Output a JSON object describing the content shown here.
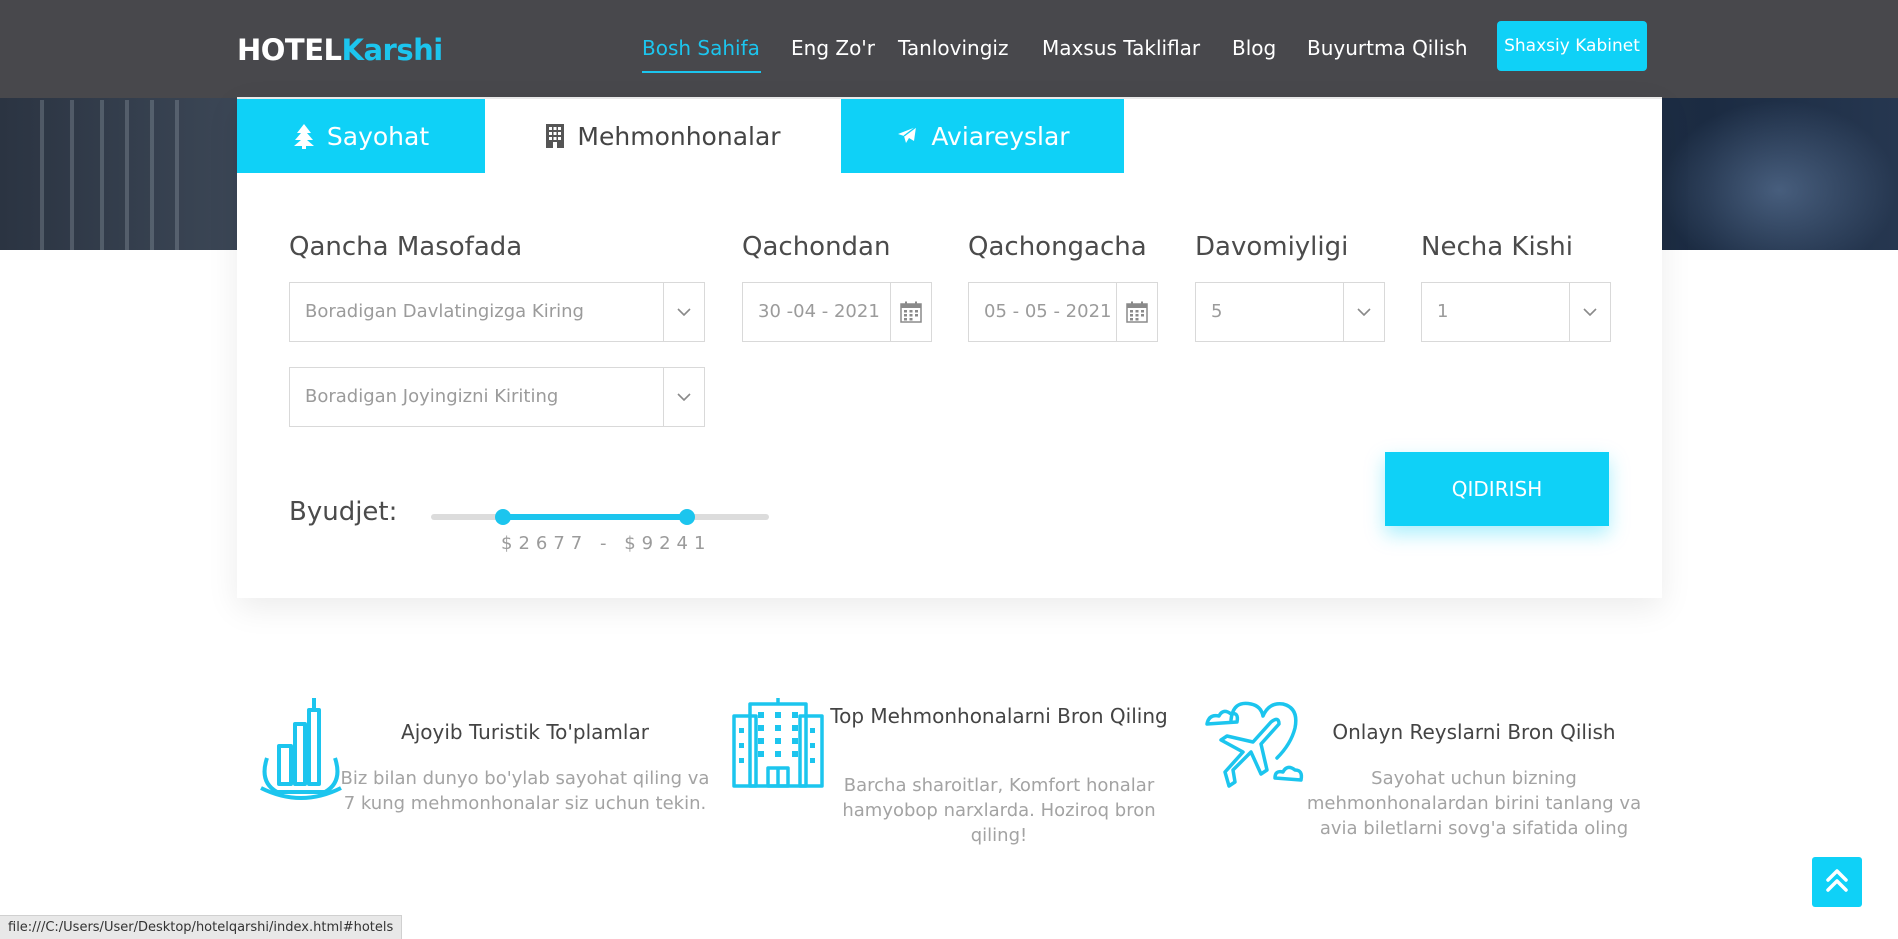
{
  "brand": {
    "part1": "HOTEL",
    "part2": "Karshi"
  },
  "nav": {
    "items": [
      {
        "label": "Bosh Sahifa",
        "active": true
      },
      {
        "label": "Eng Zo'r"
      },
      {
        "label": "Tanlovingiz"
      },
      {
        "label": "Maxsus Takliflar"
      },
      {
        "label": "Blog"
      },
      {
        "label": "Buyurtma Qilish"
      }
    ],
    "cabinet_label": "Shaxsiy Kabinet"
  },
  "tabs": [
    {
      "label": "Sayohat",
      "icon": "tree-icon",
      "active": false
    },
    {
      "label": "Mehmonhonalar",
      "icon": "building-icon",
      "active": true
    },
    {
      "label": "Aviareyslar",
      "icon": "plane-icon",
      "active": false
    }
  ],
  "search": {
    "distance": {
      "label": "Qancha Masofada",
      "country_placeholder": "Boradigan Davlatingizga Kiring",
      "place_placeholder": "Boradigan Joyingizni Kiriting"
    },
    "from": {
      "label": "Qachondan",
      "value": "30 -04 - 2021"
    },
    "to": {
      "label": "Qachongacha",
      "value": "05 - 05 - 2021"
    },
    "duration": {
      "label": "Davomiyligi",
      "value": "5"
    },
    "people": {
      "label": "Necha Kishi",
      "value": "1"
    },
    "budget": {
      "label": "Byudjet:",
      "range": "$2677 - $9241",
      "min": 2677,
      "max": 9241
    },
    "submit_label": "QIDIRISH"
  },
  "features": [
    {
      "icon": "tourist-package-icon",
      "title": "Ajoyib Turistik To'plamlar",
      "description": "Biz bilan dunyo bo'ylab sayohat qiling va 7 kung mehmonhonalar siz uchun tekin."
    },
    {
      "icon": "hotel-building-icon",
      "title": "Top Mehmonhonalarni Bron Qiling",
      "description": "Barcha sharoitlar, Komfort honalar hamyobop narxlarda. Hoziroq bron qiling!"
    },
    {
      "icon": "airplane-heart-icon",
      "title": "Onlayn Reyslarni Bron Qilish",
      "description": "Sayohat uchun bizning mehmonhonalardan birini tanlang va avia biletlarni sovg'a sifatida oling"
    }
  ],
  "status_bar": {
    "url": "file:///C:/Users/User/Desktop/hotelqarshi/index.html#hotels"
  },
  "colors": {
    "accent": "#0fd1f7",
    "nav_bg": "#48484c"
  }
}
